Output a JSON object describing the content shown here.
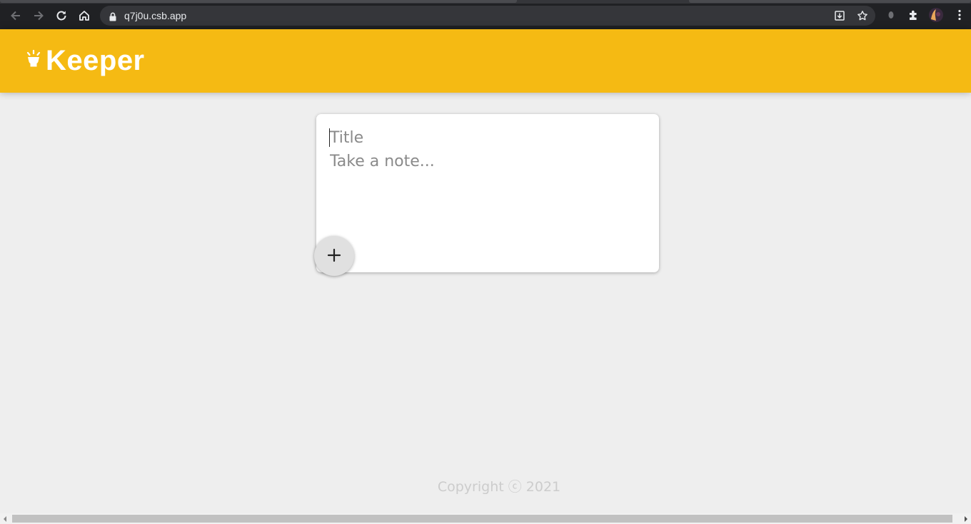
{
  "browser": {
    "url": "q7j0u.csb.app",
    "icons": [
      "back-icon",
      "forward-icon",
      "reload-icon",
      "home-icon",
      "lock-icon",
      "install-icon",
      "star-icon",
      "extension-dot-icon",
      "puzzle-icon",
      "profile-avatar",
      "menu-dots-icon"
    ]
  },
  "app": {
    "brand": "Keeper",
    "brand_color": "#f5ba13",
    "logo_icon": "lightbulb-icon"
  },
  "form": {
    "title_placeholder": "Title",
    "content_placeholder": "Take a note...",
    "add_icon": "plus-icon"
  },
  "footer": {
    "text": "Copyright ⓒ 2021"
  }
}
